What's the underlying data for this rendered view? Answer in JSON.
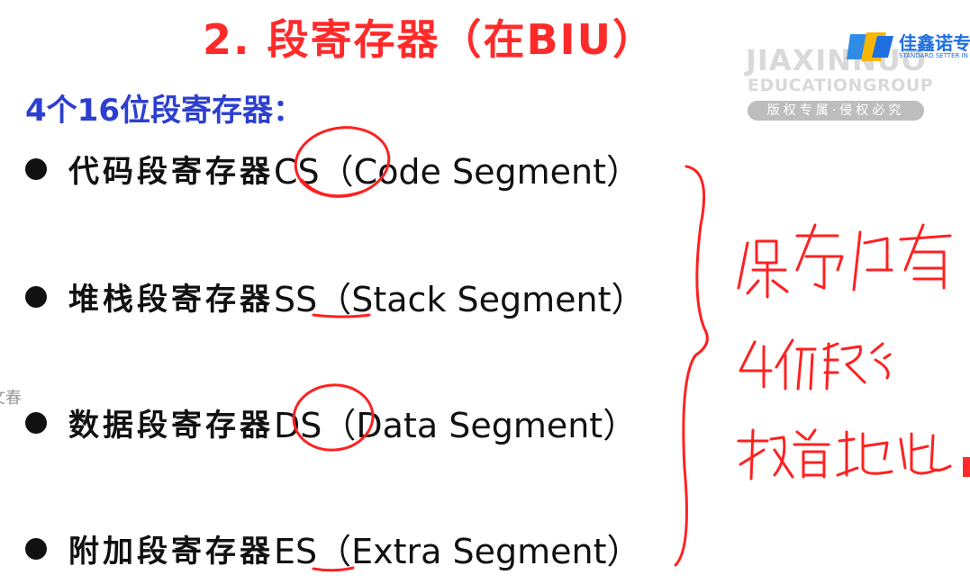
{
  "title": "2. 段寄存器（在BIU）",
  "subtitle": "4个16位段寄存器：",
  "items": [
    {
      "cn": "代码段寄存器",
      "en": "CS（Code Segment）"
    },
    {
      "cn": "堆栈段寄存器",
      "en": "SS（Stack Segment）"
    },
    {
      "cn": "数据段寄存器",
      "en": "DS（Data Segment）"
    },
    {
      "cn": "附加段寄存器",
      "en": "ES（Extra Segment）"
    }
  ],
  "watermark": {
    "line1": "JIAXINNUO",
    "line2": "EDUCATIONGROUP",
    "badge": "版权专属·侵权必究"
  },
  "brand": {
    "name": "佳鑫诺专",
    "tagline": "STANDARD SETTER IN IT"
  },
  "side_text": "文春",
  "handwritten_note": "保存内存4个段的段首地址",
  "colors": {
    "title": "#ff2a2a",
    "subtitle": "#2c3fcf",
    "annotation": "#ff2020",
    "brand": "#1d6fe0"
  }
}
